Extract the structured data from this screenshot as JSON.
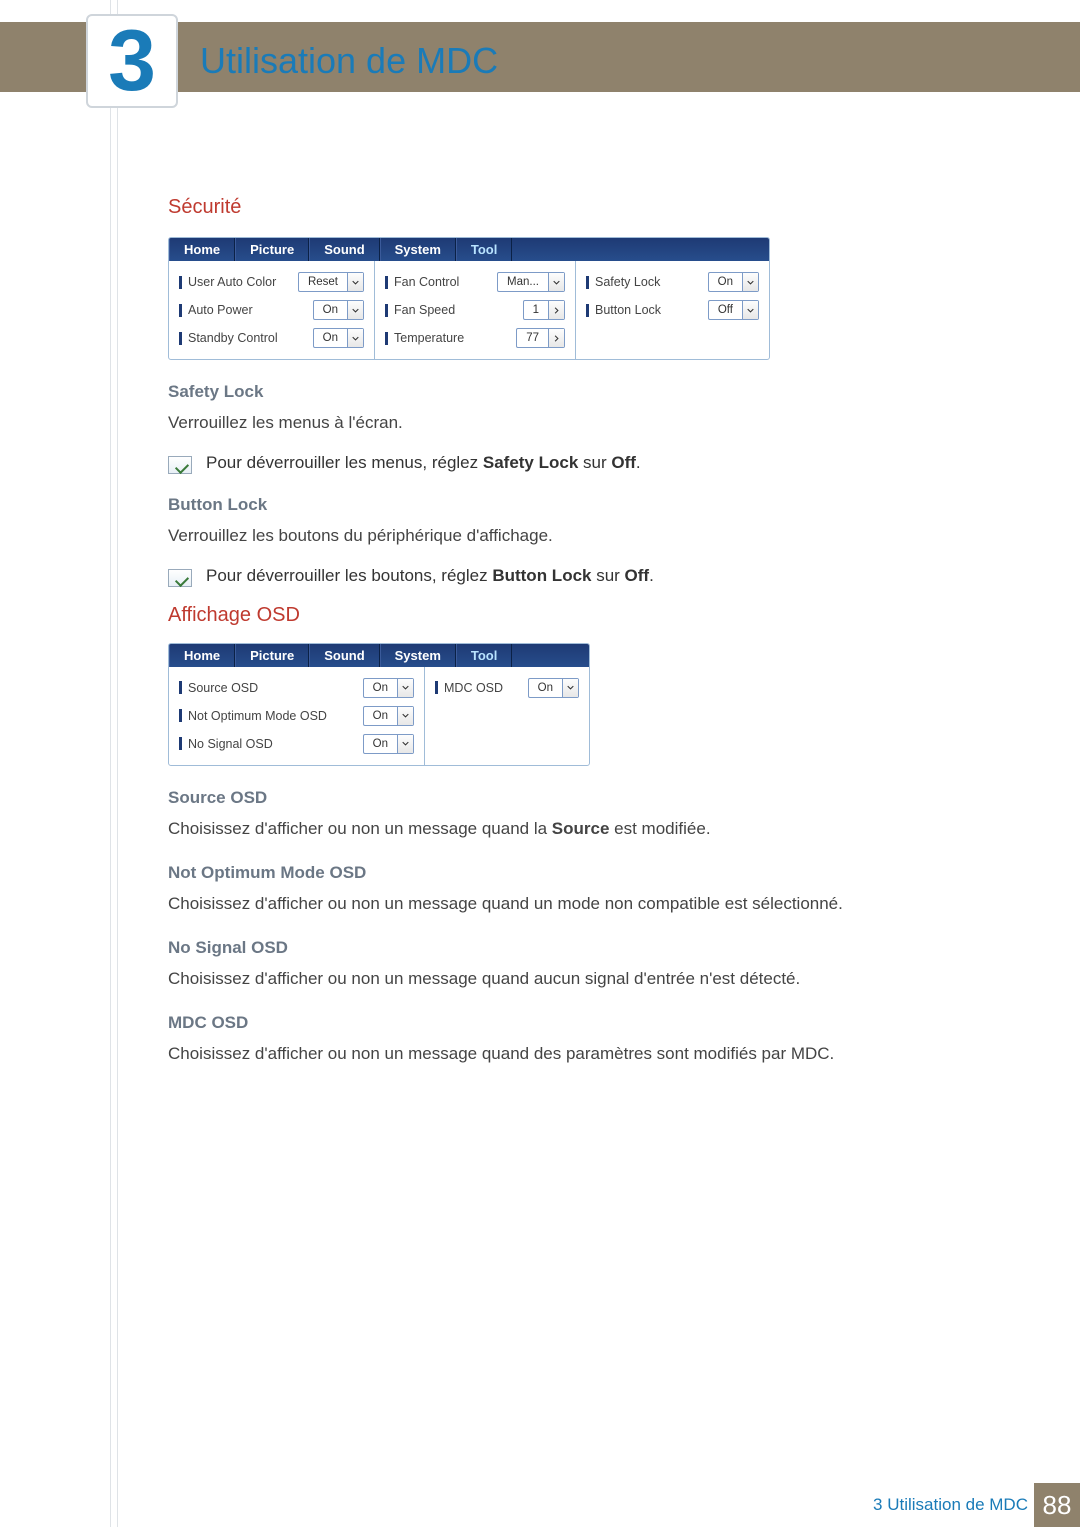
{
  "chapter": {
    "number": "3",
    "title": "Utilisation de MDC"
  },
  "section1": {
    "heading": "Sécurité",
    "panel": {
      "tabs": [
        "Home",
        "Picture",
        "Sound",
        "System",
        "Tool"
      ],
      "col1": [
        {
          "label": "User Auto Color",
          "value": "Reset"
        },
        {
          "label": "Auto Power",
          "value": "On"
        },
        {
          "label": "Standby Control",
          "value": "On"
        }
      ],
      "col2": [
        {
          "label": "Fan Control",
          "value": "Man..."
        },
        {
          "label": "Fan Speed",
          "value": "1"
        },
        {
          "label": "Temperature",
          "value": "77"
        }
      ],
      "col3": [
        {
          "label": "Safety Lock",
          "value": "On"
        },
        {
          "label": "Button Lock",
          "value": "Off"
        }
      ]
    },
    "items": [
      {
        "title": "Safety Lock",
        "text": "Verrouillez les menus à l'écran.",
        "note_pre": "Pour déverrouiller les menus, réglez ",
        "note_bold1": "Safety Lock",
        "note_mid": " sur ",
        "note_bold2": "Off",
        "note_post": "."
      },
      {
        "title": "Button Lock",
        "text": "Verrouillez les boutons du périphérique d'affichage.",
        "note_pre": "Pour déverrouiller les boutons, réglez ",
        "note_bold1": "Button Lock",
        "note_mid": " sur ",
        "note_bold2": "Off",
        "note_post": "."
      }
    ]
  },
  "section2": {
    "heading": "Affichage OSD",
    "panel": {
      "tabs": [
        "Home",
        "Picture",
        "Sound",
        "System",
        "Tool"
      ],
      "col1": [
        {
          "label": "Source OSD",
          "value": "On"
        },
        {
          "label": "Not Optimum Mode OSD",
          "value": "On"
        },
        {
          "label": "No Signal OSD",
          "value": "On"
        }
      ],
      "col2": [
        {
          "label": "MDC OSD",
          "value": "On"
        }
      ]
    },
    "items": [
      {
        "title": "Source OSD",
        "pre": "Choisissez d'afficher ou non un message quand la ",
        "bold": "Source",
        "post": " est modifiée."
      },
      {
        "title": "Not Optimum Mode OSD",
        "text": "Choisissez d'afficher ou non un message quand un mode non compatible est sélectionné."
      },
      {
        "title": "No Signal OSD",
        "text": "Choisissez d'afficher ou non un message quand aucun signal d'entrée n'est détecté."
      },
      {
        "title": "MDC OSD",
        "text": "Choisissez d'afficher ou non un message quand des paramètres sont modifiés par MDC."
      }
    ]
  },
  "footer": {
    "text": "3 Utilisation de MDC",
    "page": "88"
  }
}
